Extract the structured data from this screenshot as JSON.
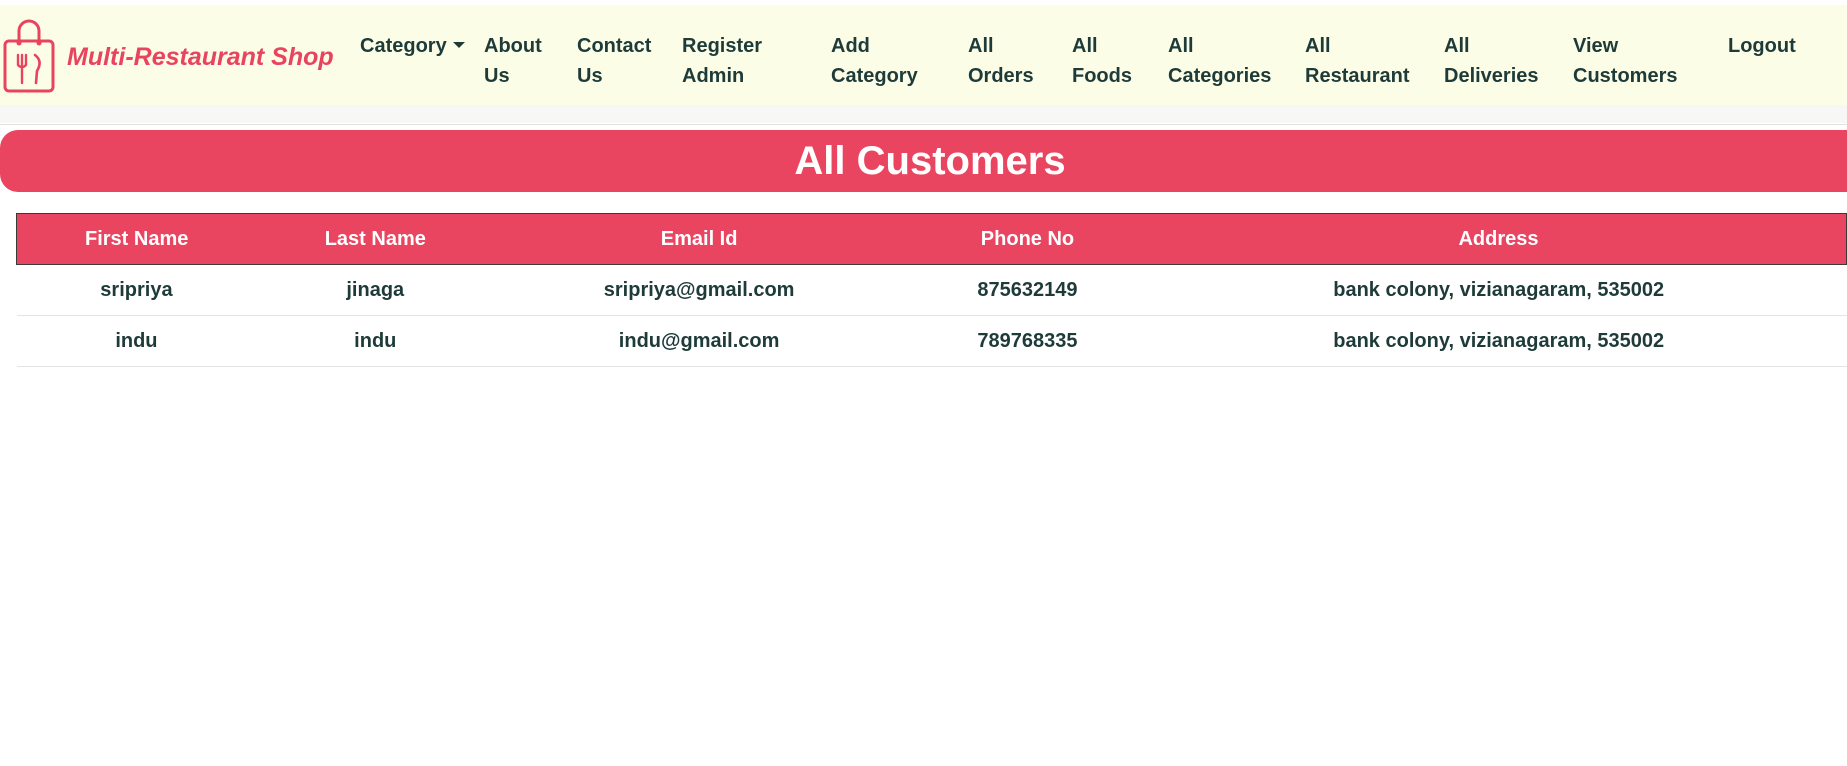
{
  "brand": {
    "name": "Multi-Restaurant Shop",
    "logo_icon": "shopping-bag-fork-knife-icon",
    "color": "#e8435f"
  },
  "nav": {
    "category": "Category",
    "about": [
      "About",
      "Us"
    ],
    "contact": [
      "Contact",
      "Us"
    ],
    "register_admin": [
      "Register",
      "Admin"
    ],
    "add_category": [
      "Add",
      "Category"
    ],
    "all_orders": [
      "All",
      "Orders"
    ],
    "all_foods": [
      "All",
      "Foods"
    ],
    "all_categories": [
      "All",
      "Categories"
    ],
    "all_restaurant": [
      "All",
      "Restaurant"
    ],
    "all_deliveries": [
      "All",
      "Deliveries"
    ],
    "view_customers": [
      "View",
      "Customers"
    ],
    "logout": "Logout"
  },
  "page": {
    "title": "All Customers"
  },
  "table": {
    "headers": [
      "First Name",
      "Last Name",
      "Email Id",
      "Phone No",
      "Address"
    ],
    "rows": [
      [
        "sripriya",
        "jinaga",
        "sripriya@gmail.com",
        "875632149",
        "bank colony, vizianagaram, 535002"
      ],
      [
        "indu",
        "indu",
        "indu@gmail.com",
        "789768335",
        "bank colony, vizianagaram, 535002"
      ]
    ]
  },
  "colors": {
    "accent": "#ea4560",
    "navbar_bg": "#fbfde6",
    "text": "#1e3b3a"
  }
}
